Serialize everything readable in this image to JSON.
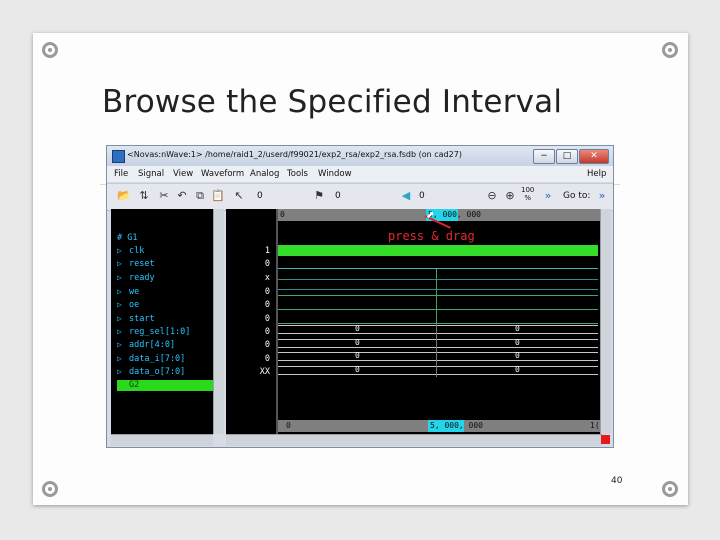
{
  "slide": {
    "title": "Browse the Specified Interval",
    "page_number": "40"
  },
  "window": {
    "title": "<Novas:nWave:1> /home/raid1_2/userd/f99021/exp2_rsa/exp2_rsa.fsdb (on cad27)",
    "controls": [
      "−",
      "□",
      "✕"
    ]
  },
  "menubar": [
    "File",
    "Signal",
    "View",
    "Waveform",
    "Analog",
    "Tools",
    "Window",
    "Help"
  ],
  "toolbar": {
    "field1": "0",
    "field2": "0",
    "field3": "0",
    "zoom": "100",
    "zoom_unit": "%",
    "goto_label": "Go to:"
  },
  "signals": {
    "group1": "# G1",
    "items": [
      "clk",
      "reset",
      "ready",
      "we",
      "oe",
      "start",
      "reg_sel[1:0]",
      "addr[4:0]",
      "data_i[7:0]",
      "data_o[7:0]"
    ],
    "group2": "G2"
  },
  "values": [
    "1",
    "0",
    "x",
    "0",
    "0",
    "0",
    "0",
    "0",
    "0",
    "XX"
  ],
  "waveform": {
    "ruler_start": "0",
    "ruler_selected": "5, 000, 000",
    "bottom_start": "0",
    "bottom_selected": "5, 000, 000",
    "bottom_end": "1(",
    "annotation": "press & drag",
    "bus_values": [
      {
        "left": "0",
        "right": "0"
      },
      {
        "left": "0",
        "right": "0"
      },
      {
        "left": "0",
        "right": "0"
      },
      {
        "left": "0",
        "right": "0"
      }
    ]
  },
  "colors": {
    "signal_text": "#29c6ff",
    "group_highlight": "#2bd81b",
    "annotation": "#e22b2b",
    "ruler_selection": "#25d4e8"
  }
}
